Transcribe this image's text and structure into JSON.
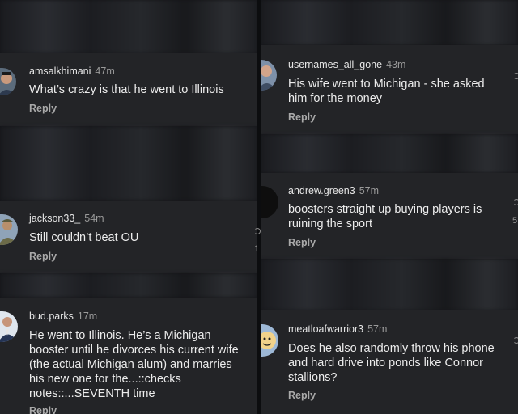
{
  "left_column": {
    "comments": [
      {
        "username": "amsalkhimani",
        "time": "47m",
        "text": "What’s crazy is that he went to Illinois",
        "reply": "Reply",
        "avatar_icon": "person-avatar-icon"
      },
      {
        "username": "jackson33_",
        "time": "54m",
        "text": "Still couldn’t beat OU",
        "reply": "Reply",
        "avatar_icon": "soldier-avatar-icon"
      },
      {
        "username": "bud.parks",
        "time": "17m",
        "text": "He went to Illinois. He’s a Michigan booster until he divorces his current wife (the actual Michigan alum) and marries his new one for the...::checks notes::...SEVENTH time",
        "reply": "Reply",
        "avatar_icon": "suit-avatar-icon"
      }
    ]
  },
  "right_column": {
    "comments": [
      {
        "username": "usernames_all_gone",
        "time": "43m",
        "text": "His wife went to Michigan - she asked him for  the money",
        "reply": "Reply",
        "avatar_icon": "man-avatar-icon"
      },
      {
        "username": "andrew.green3",
        "time": "57m",
        "text": "boosters straight up buying players is ruining the sport",
        "reply": "Reply",
        "avatar_icon": "dark-avatar-icon"
      },
      {
        "username": "meatloafwarrior3",
        "time": "57m",
        "text": "Does he also randomly throw his phone and hard drive into ponds like Connor stallions?",
        "reply": "Reply",
        "avatar_icon": "cartoon-avatar-icon"
      }
    ]
  },
  "edge_counts": {
    "right_edge_number": "5",
    "mid_edge_number": "1"
  },
  "colors": {
    "card_bg": "#232427",
    "page_bg": "#111214",
    "text": "#ececec",
    "muted": "#9a9a9a"
  }
}
